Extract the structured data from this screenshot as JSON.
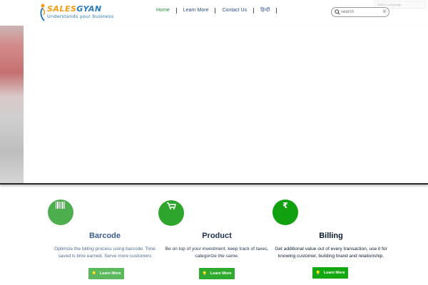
{
  "brand": {
    "name_part1": "SALES",
    "name_part2": "GYAN",
    "tagline": "Understands your business",
    "accent_orange": "#f39c12",
    "accent_blue": "#2b7bb9"
  },
  "nav": {
    "items": [
      {
        "label": "Home",
        "active": true
      },
      {
        "label": "Learn More",
        "active": false
      },
      {
        "label": "Contact Us",
        "active": false
      },
      {
        "label": "हिन्दी",
        "active": false
      }
    ],
    "active_color": "#2a8a3e",
    "color": "#2d4f8c"
  },
  "search": {
    "placeholder": "search",
    "icon": "search-icon",
    "clear_symbol": "⊗"
  },
  "lang_widget": {
    "label": "Select Language"
  },
  "features": [
    {
      "title": "Barcode",
      "description": "Optimize the billing process using barcode. Time saved is time earned. Serve more customers",
      "button_label": "Learn More",
      "icon": "barcode-icon",
      "circle_color": "#4cae4c",
      "title_color": "#3d5d8c",
      "desc_color": "#4f6d96",
      "button_color": "#5cb85c"
    },
    {
      "title": "Product",
      "description": "Be on top of your investment, keep track of taxes, categorize the same.",
      "button_label": "Learn More",
      "icon": "cart-icon",
      "circle_color": "#2ea62e",
      "title_color": "#1f2f4f",
      "desc_color": "#1f2f4f",
      "button_color": "#2eaa2e"
    },
    {
      "title": "Billing",
      "description": "Get additional value out of every transaction, use it for knowing customer, building brand and relationship.",
      "button_label": "Learn More",
      "icon": "rupee-icon",
      "circle_color": "#10a010",
      "title_color": "#0a1a30",
      "desc_color": "#0a1a30",
      "button_color": "#11a811"
    }
  ]
}
